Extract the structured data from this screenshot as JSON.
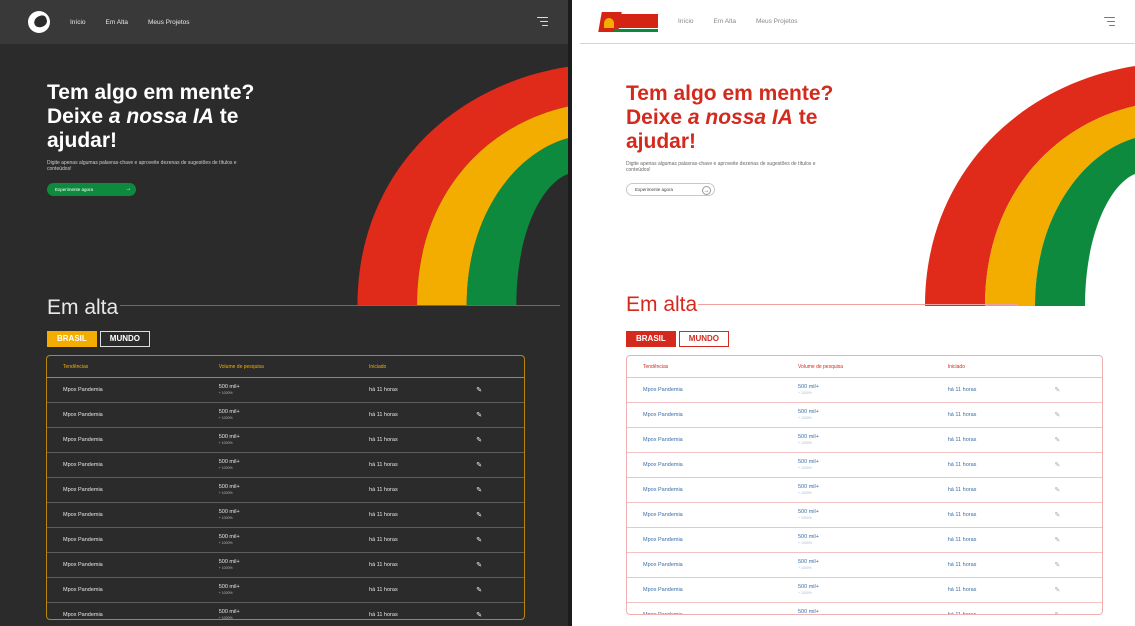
{
  "nav": [
    "Início",
    "Em Alta",
    "Meus Projetos"
  ],
  "hero": {
    "line1": "Tem algo em mente?",
    "line2_pre": "Deixe ",
    "line2_em": "a nossa IA",
    "line2_post": " te",
    "line3": "ajudar!",
    "subtitle": "Digite apenas algumas palavras-chave e aproveite dezenas de sugestões de títulos e conteúdos!",
    "cta": "Experimente agora"
  },
  "section_title": "Em alta",
  "tabs": [
    "BRASIL",
    "MUNDO"
  ],
  "table": {
    "headers": [
      "Tendências",
      "Volume de pesquisa",
      "Iniciado"
    ],
    "rows": [
      {
        "trend": "Mpox Pandemia",
        "volume": "500 mil+",
        "change": "+ 1000%",
        "started": "há 11 horas"
      },
      {
        "trend": "Mpox Pandemia",
        "volume": "500 mil+",
        "change": "+ 1000%",
        "started": "há 11 horas"
      },
      {
        "trend": "Mpox Pandemia",
        "volume": "500 mil+",
        "change": "+ 1000%",
        "started": "há 11 horas"
      },
      {
        "trend": "Mpox Pandemia",
        "volume": "500 mil+",
        "change": "+ 1000%",
        "started": "há 11 horas"
      },
      {
        "trend": "Mpox Pandemia",
        "volume": "500 mil+",
        "change": "+ 1000%",
        "started": "há 11 horas"
      },
      {
        "trend": "Mpox Pandemia",
        "volume": "500 mil+",
        "change": "+ 1000%",
        "started": "há 11 horas"
      },
      {
        "trend": "Mpox Pandemia",
        "volume": "500 mil+",
        "change": "+ 1000%",
        "started": "há 11 horas"
      },
      {
        "trend": "Mpox Pandemia",
        "volume": "500 mil+",
        "change": "+ 1000%",
        "started": "há 11 horas"
      },
      {
        "trend": "Mpox Pandemia",
        "volume": "500 mil+",
        "change": "+ 1000%",
        "started": "há 11 horas"
      },
      {
        "trend": "Mpox Pandemia",
        "volume": "500 mil+",
        "change": "+ 1000%",
        "started": "há 11 horas"
      }
    ]
  },
  "colors": {
    "dark_bg": "#2b2b2b",
    "red": "#d42a1e",
    "yellow": "#f3ad00",
    "green": "#0d8a3d"
  },
  "icons": {
    "menu": "hamburger-menu-icon",
    "edit": "pencil-icon",
    "arrow": "arrow-right-icon"
  }
}
